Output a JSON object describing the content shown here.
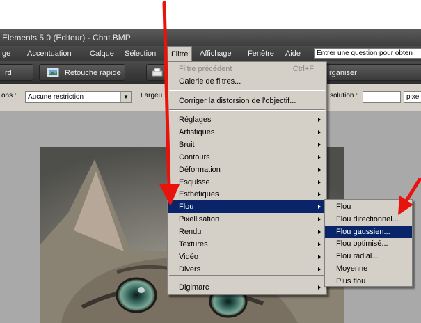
{
  "window": {
    "title": "Elements 5.0 (Editeur) - Chat.BMP"
  },
  "menubar": {
    "items": [
      "ge",
      "Accentuation",
      "Calque",
      "Sélection",
      "Filtre",
      "Affichage",
      "Fenêtre",
      "Aide"
    ],
    "active": "Filtre",
    "help_placeholder": "Entrer une question pour obten"
  },
  "modebar": {
    "standard_label": "rd",
    "quickfix_label": "Retouche rapide",
    "organize_label": "rganiser"
  },
  "options": {
    "constraint_label": "ons :",
    "constraint_value": "Aucune restriction",
    "width_label": "Largeu",
    "resolution_label": "solution :",
    "resolution_value": "",
    "unit_value": "pixel"
  },
  "filter_menu": {
    "last_filter": "Filtre précédent",
    "last_filter_shortcut": "Ctrl+F",
    "gallery": "Galerie de filtres...",
    "lens": "Corriger la distorsion de l'objectif...",
    "categories": [
      "Réglages",
      "Artistiques",
      "Bruit",
      "Contours",
      "Déformation",
      "Esquisse",
      "Esthétiques",
      "Flou",
      "Pixellisation",
      "Rendu",
      "Textures",
      "Vidéo",
      "Divers"
    ],
    "highlighted": "Flou",
    "digimarc": "Digimarc"
  },
  "blur_submenu": {
    "items": [
      "Flou",
      "Flou directionnel...",
      "Flou gaussien...",
      "Flou optimisé...",
      "Flou radial...",
      "Moyenne",
      "Plus flou"
    ],
    "highlighted": "Flou gaussien..."
  },
  "colors": {
    "menu_bg": "#d4d0c8",
    "highlight": "#0a246a",
    "annotation_arrow": "#e8140c",
    "titlebar": "#4a4a4a"
  }
}
